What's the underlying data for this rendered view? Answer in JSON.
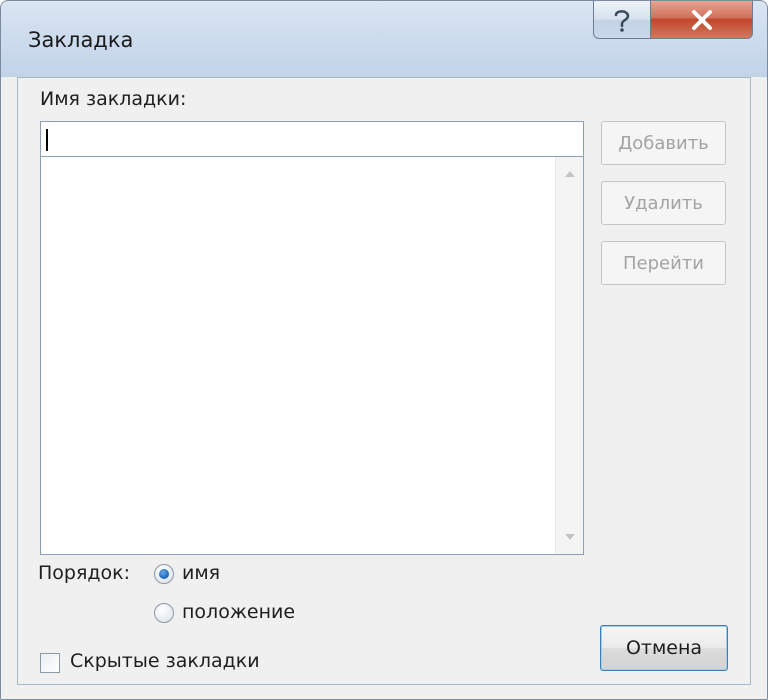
{
  "window": {
    "title": "Закладка"
  },
  "caption": {
    "help_glyph": "?",
    "close_glyph": "✕",
    "icons": [
      "help-icon",
      "close-icon"
    ]
  },
  "form": {
    "name_label": "Имя закладки:",
    "name_value": "",
    "bookmarks": []
  },
  "buttons": {
    "add": "Добавить",
    "delete": "Удалить",
    "goto": "Перейти",
    "cancel": "Отмена"
  },
  "sort": {
    "label": "Порядок:",
    "options": [
      {
        "label": "имя",
        "checked": true
      },
      {
        "label": "положение",
        "checked": false
      }
    ]
  },
  "hidden_bookmarks": {
    "label": "Скрытые закладки",
    "checked": false
  },
  "colors": {
    "accent": "#1f6fc4",
    "close_red": "#c2462c",
    "disabled_text": "#a3a3a3"
  }
}
